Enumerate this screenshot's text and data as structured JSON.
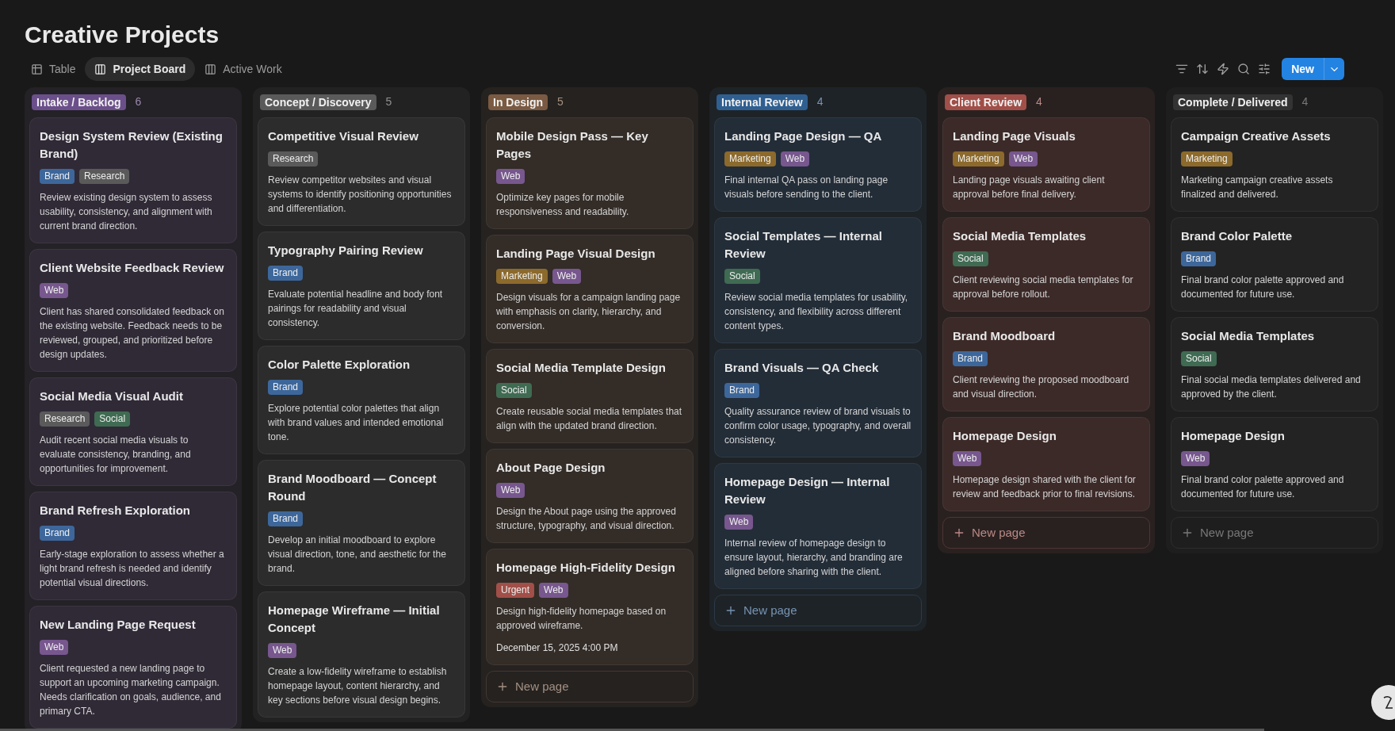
{
  "page": {
    "title": "Creative Projects"
  },
  "tabs": [
    {
      "label": "Table",
      "kind": "table",
      "selected": false
    },
    {
      "label": "Project Board",
      "kind": "board",
      "selected": true
    },
    {
      "label": "Active Work",
      "kind": "board",
      "selected": false
    }
  ],
  "toolbar": {
    "new_button": "New"
  },
  "columns": [
    {
      "label": "Intake / Backlog",
      "count": "6",
      "color": "#6b4f8a",
      "cards": [
        {
          "title": "Design System Review (Existing Brand)",
          "tags": [
            {
              "label": "Brand",
              "color": "#3d679b"
            },
            {
              "label": "Research",
              "color": "#5a5a5a"
            }
          ],
          "description": "Review existing design system to assess usability, consistency, and alignment with current brand direction."
        },
        {
          "title": "Client Website Feedback Review",
          "tags": [
            {
              "label": "Web",
              "color": "#77578e"
            }
          ],
          "description": "Client has shared consolidated feedback on the existing website. Feedback needs to be reviewed, grouped, and prioritized before design updates."
        },
        {
          "title": "Social Media Visual Audit",
          "tags": [
            {
              "label": "Research",
              "color": "#5a5a5a"
            },
            {
              "label": "Social",
              "color": "#3f6b52"
            }
          ],
          "description": "Audit recent social media visuals to evaluate consistency, branding, and opportunities for improvement."
        },
        {
          "title": "Brand Refresh Exploration",
          "tags": [
            {
              "label": "Brand",
              "color": "#3d679b"
            }
          ],
          "description": "Early-stage exploration to assess whether a light brand refresh is needed and identify potential visual directions."
        },
        {
          "title": "New Landing Page Request",
          "tags": [
            {
              "label": "Web",
              "color": "#77578e"
            }
          ],
          "description": "Client requested a new landing page to support an upcoming marketing campaign. Needs clarification on goals, audience, and primary CTA."
        }
      ]
    },
    {
      "label": "Concept / Discovery",
      "count": "5",
      "color": "#5a5a5a",
      "cards": [
        {
          "title": "Competitive Visual Review",
          "tags": [
            {
              "label": "Research",
              "color": "#5a5a5a"
            }
          ],
          "description": "Review competitor websites and visual systems to identify positioning opportunities and differentiation."
        },
        {
          "title": "Typography Pairing Review",
          "tags": [
            {
              "label": "Brand",
              "color": "#3d679b"
            }
          ],
          "description": "Evaluate potential headline and body font pairings for readability and visual consistency."
        },
        {
          "title": "Color Palette Exploration",
          "tags": [
            {
              "label": "Brand",
              "color": "#3d679b"
            }
          ],
          "description": "Explore potential color palettes that align with brand values and intended emotional tone."
        },
        {
          "title": "Brand Moodboard — Concept Round",
          "tags": [
            {
              "label": "Brand",
              "color": "#3d679b"
            }
          ],
          "description": "Develop an initial moodboard to explore visual direction, tone, and aesthetic for the brand."
        },
        {
          "title": "Homepage Wireframe — Initial Concept",
          "tags": [
            {
              "label": "Web",
              "color": "#77578e"
            }
          ],
          "description": "Create a low-fidelity wireframe to establish homepage layout, content hierarchy, and key sections before visual design begins."
        }
      ]
    },
    {
      "label": "In Design",
      "count": "5",
      "color": "#7a5a42",
      "new_page": "New page",
      "cards": [
        {
          "title": "Mobile Design Pass — Key Pages",
          "tags": [
            {
              "label": "Web",
              "color": "#77578e"
            }
          ],
          "description": "Optimize key pages for mobile responsiveness and readability."
        },
        {
          "title": "Landing Page Visual Design",
          "tags": [
            {
              "label": "Marketing",
              "color": "#8c6a2c"
            },
            {
              "label": "Web",
              "color": "#77578e"
            }
          ],
          "description": "Design visuals for a campaign landing page with emphasis on clarity, hierarchy, and conversion."
        },
        {
          "title": "Social Media Template Design",
          "tags": [
            {
              "label": "Social",
              "color": "#3f6b52"
            }
          ],
          "description": "Create reusable social media templates that align with the updated brand direction."
        },
        {
          "title": "About Page Design",
          "tags": [
            {
              "label": "Web",
              "color": "#77578e"
            }
          ],
          "description": "Design the About page using the approved structure, typography, and visual direction."
        },
        {
          "title": "Homepage High-Fidelity Design",
          "tags": [
            {
              "label": "Urgent",
              "color": "#a14f48"
            },
            {
              "label": "Web",
              "color": "#77578e"
            }
          ],
          "description": "Design high-fidelity homepage based on approved wireframe.",
          "date": "December 15, 2025 4:00 PM"
        }
      ]
    },
    {
      "label": "Internal Review",
      "count": "4",
      "color": "#2f5f91",
      "new_page": "New page",
      "cards": [
        {
          "title": "Landing Page Design — QA",
          "tags": [
            {
              "label": "Marketing",
              "color": "#8c6a2c"
            },
            {
              "label": "Web",
              "color": "#77578e"
            }
          ],
          "description": "Final internal QA pass on landing page visuals before sending to the client."
        },
        {
          "title": "Social Templates — Internal Review",
          "tags": [
            {
              "label": "Social",
              "color": "#3f6b52"
            }
          ],
          "description": "Review social media templates for usability, consistency, and flexibility across different content types."
        },
        {
          "title": "Brand Visuals — QA Check",
          "tags": [
            {
              "label": "Brand",
              "color": "#3d679b"
            }
          ],
          "description": "Quality assurance review of brand visuals to confirm color usage, typography, and overall consistency."
        },
        {
          "title": "Homepage Design — Internal Review",
          "tags": [
            {
              "label": "Web",
              "color": "#77578e"
            }
          ],
          "description": "Internal review of homepage design to ensure layout, hierarchy, and branding are aligned before sharing with the client."
        }
      ]
    },
    {
      "label": "Client Review",
      "count": "4",
      "color": "#a14f48",
      "new_page": "New page",
      "cards": [
        {
          "title": "Landing Page Visuals",
          "tags": [
            {
              "label": "Marketing",
              "color": "#8c6a2c"
            },
            {
              "label": "Web",
              "color": "#77578e"
            }
          ],
          "description": "Landing page visuals awaiting client approval before final delivery."
        },
        {
          "title": "Social Media Templates",
          "tags": [
            {
              "label": "Social",
              "color": "#3f6b52"
            }
          ],
          "description": "Client reviewing social media templates for approval before rollout."
        },
        {
          "title": "Brand Moodboard",
          "tags": [
            {
              "label": "Brand",
              "color": "#3d679b"
            }
          ],
          "description": "Client reviewing the proposed moodboard and visual direction."
        },
        {
          "title": "Homepage Design",
          "tags": [
            {
              "label": "Web",
              "color": "#77578e"
            }
          ],
          "description": "Homepage design shared with the client for review and feedback prior to final revisions."
        }
      ]
    },
    {
      "label": "Complete / Delivered",
      "count": "4",
      "color": "#333333",
      "new_page": "New page",
      "cards": [
        {
          "title": "Campaign Creative Assets",
          "tags": [
            {
              "label": "Marketing",
              "color": "#8c6a2c"
            }
          ],
          "description": "Marketing campaign creative assets finalized and delivered."
        },
        {
          "title": "Brand Color Palette",
          "tags": [
            {
              "label": "Brand",
              "color": "#3d679b"
            }
          ],
          "description": "Final brand color palette approved and documented for future use."
        },
        {
          "title": "Social Media Templates",
          "tags": [
            {
              "label": "Social",
              "color": "#3f6b52"
            }
          ],
          "description": "Final social media templates delivered and approved by the client."
        },
        {
          "title": "Homepage Design",
          "tags": [
            {
              "label": "Web",
              "color": "#77578e"
            }
          ],
          "description": "Final brand color palette approved and documented for future use."
        }
      ]
    }
  ]
}
